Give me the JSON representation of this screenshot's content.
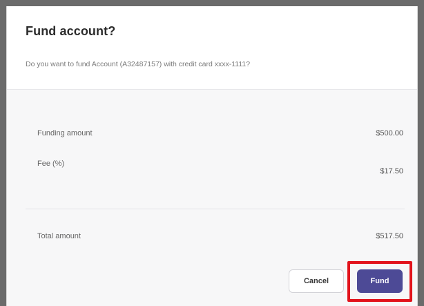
{
  "dialog": {
    "title": "Fund account?",
    "subtitle": "Do you want to fund Account (A32487157) with credit card xxxx-1111?"
  },
  "summary": {
    "funding_amount": {
      "label": "Funding amount",
      "value": "$500.00"
    },
    "fee": {
      "label": "Fee (%)",
      "value": "$17.50"
    },
    "total": {
      "label": "Total amount",
      "value": "$517.50"
    }
  },
  "actions": {
    "cancel_label": "Cancel",
    "fund_label": "Fund"
  },
  "colors": {
    "fund_button": "#4d4a96",
    "highlight": "#e2131c"
  }
}
